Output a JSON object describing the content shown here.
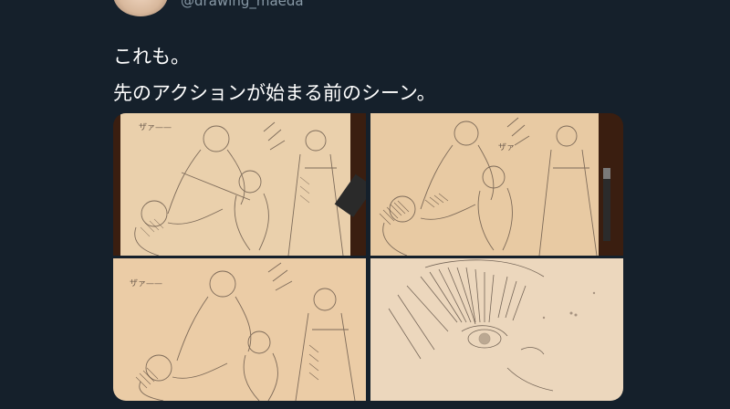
{
  "user": {
    "handle": "@drawing_maeda",
    "avatar_icon": "user-avatar"
  },
  "tweet": {
    "lines": [
      "これも。",
      "先のアクションが始まる前のシーン。"
    ]
  },
  "media": {
    "photos": [
      {
        "sfx_text": "ザァ——",
        "alt": "pencil sketch scene 1"
      },
      {
        "sfx_text": "ザァ",
        "alt": "pencil sketch scene 2"
      },
      {
        "sfx_text": "ザァ——",
        "alt": "pencil sketch scene 3"
      },
      {
        "sfx_text": "",
        "alt": "pencil sketch closeup face"
      }
    ]
  },
  "colors": {
    "background": "#15202b",
    "secondary_text": "#8899a6",
    "paper": "#e7c9a3",
    "table": "#3a1e10",
    "pencil": "#6b5a4c"
  }
}
